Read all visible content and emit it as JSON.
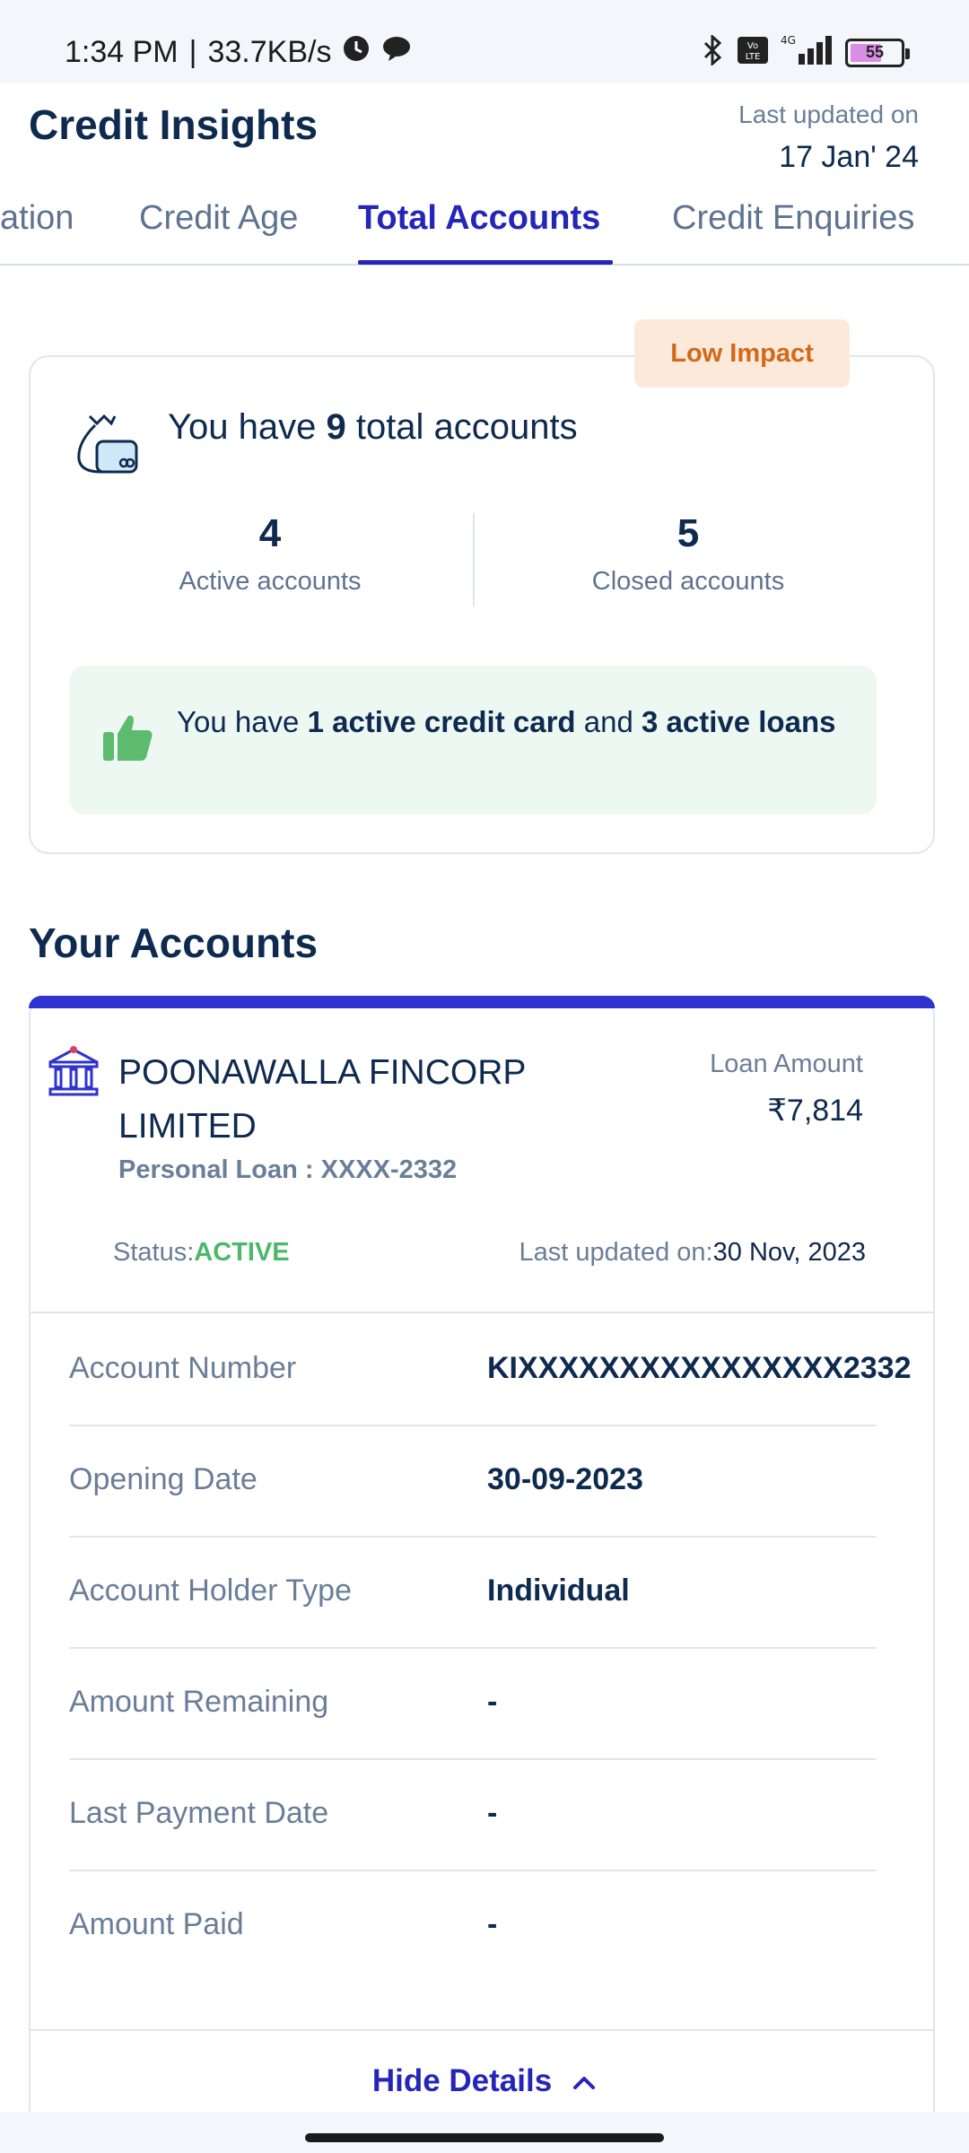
{
  "status_bar": {
    "time": "1:34 PM",
    "separator": "|",
    "net_speed": "33.7KB/s",
    "network": "4G",
    "volte": "Vo LTE",
    "battery_level": "55"
  },
  "header": {
    "title": "Credit Insights",
    "updated_label": "Last updated on",
    "updated_date": "17 Jan' 24"
  },
  "tabs": [
    {
      "label": "ation",
      "active": false
    },
    {
      "label": "Credit Age",
      "active": false
    },
    {
      "label": "Total Accounts",
      "active": true
    },
    {
      "label": "Credit Enquiries",
      "active": false
    }
  ],
  "summary": {
    "impact": "Low Impact",
    "total_prefix": "You have ",
    "total_count": "9",
    "total_suffix": " total accounts",
    "active_count": "4",
    "active_label": "Active accounts",
    "closed_count": "5",
    "closed_label": "Closed accounts",
    "info_prefix": "You have ",
    "info_card": "1 active credit card",
    "info_mid": " and ",
    "info_loans": "3 active loans"
  },
  "section_title": "Your Accounts",
  "account": {
    "bank_name": "POONAWALLA FINCORP LIMITED",
    "loan_type": "Personal Loan : XXXX-2332",
    "amount_label": "Loan Amount",
    "amount_value": "₹7,814",
    "status_label": "Status:",
    "status_value": "ACTIVE",
    "updated_label": "Last updated on:",
    "updated_value": "30 Nov, 2023",
    "details": [
      {
        "key": "Account Number",
        "value": "KIXXXXXXXXXXXXXXXX2332"
      },
      {
        "key": "Opening Date",
        "value": "30-09-2023"
      },
      {
        "key": "Account Holder Type",
        "value": "Individual"
      },
      {
        "key": "Amount Remaining",
        "value": "-"
      },
      {
        "key": "Last Payment Date",
        "value": "-"
      },
      {
        "key": "Amount Paid",
        "value": "-"
      }
    ],
    "hide_details": "Hide Details"
  },
  "colors": {
    "accent": "#2326b8",
    "accent_bar": "#2f33cf",
    "text_primary": "#0e2a4f",
    "text_secondary": "#6a7e99",
    "status_active": "#4cb86a",
    "impact_bg": "#fde9da",
    "impact_text": "#d1691a",
    "info_bg": "#eef8f3"
  },
  "icons": [
    "bluetooth-icon",
    "signal-icon",
    "battery-icon",
    "clock-icon",
    "chat-icon",
    "money-bag-icon",
    "thumbs-up-icon",
    "bank-icon",
    "chevron-up-icon"
  ]
}
